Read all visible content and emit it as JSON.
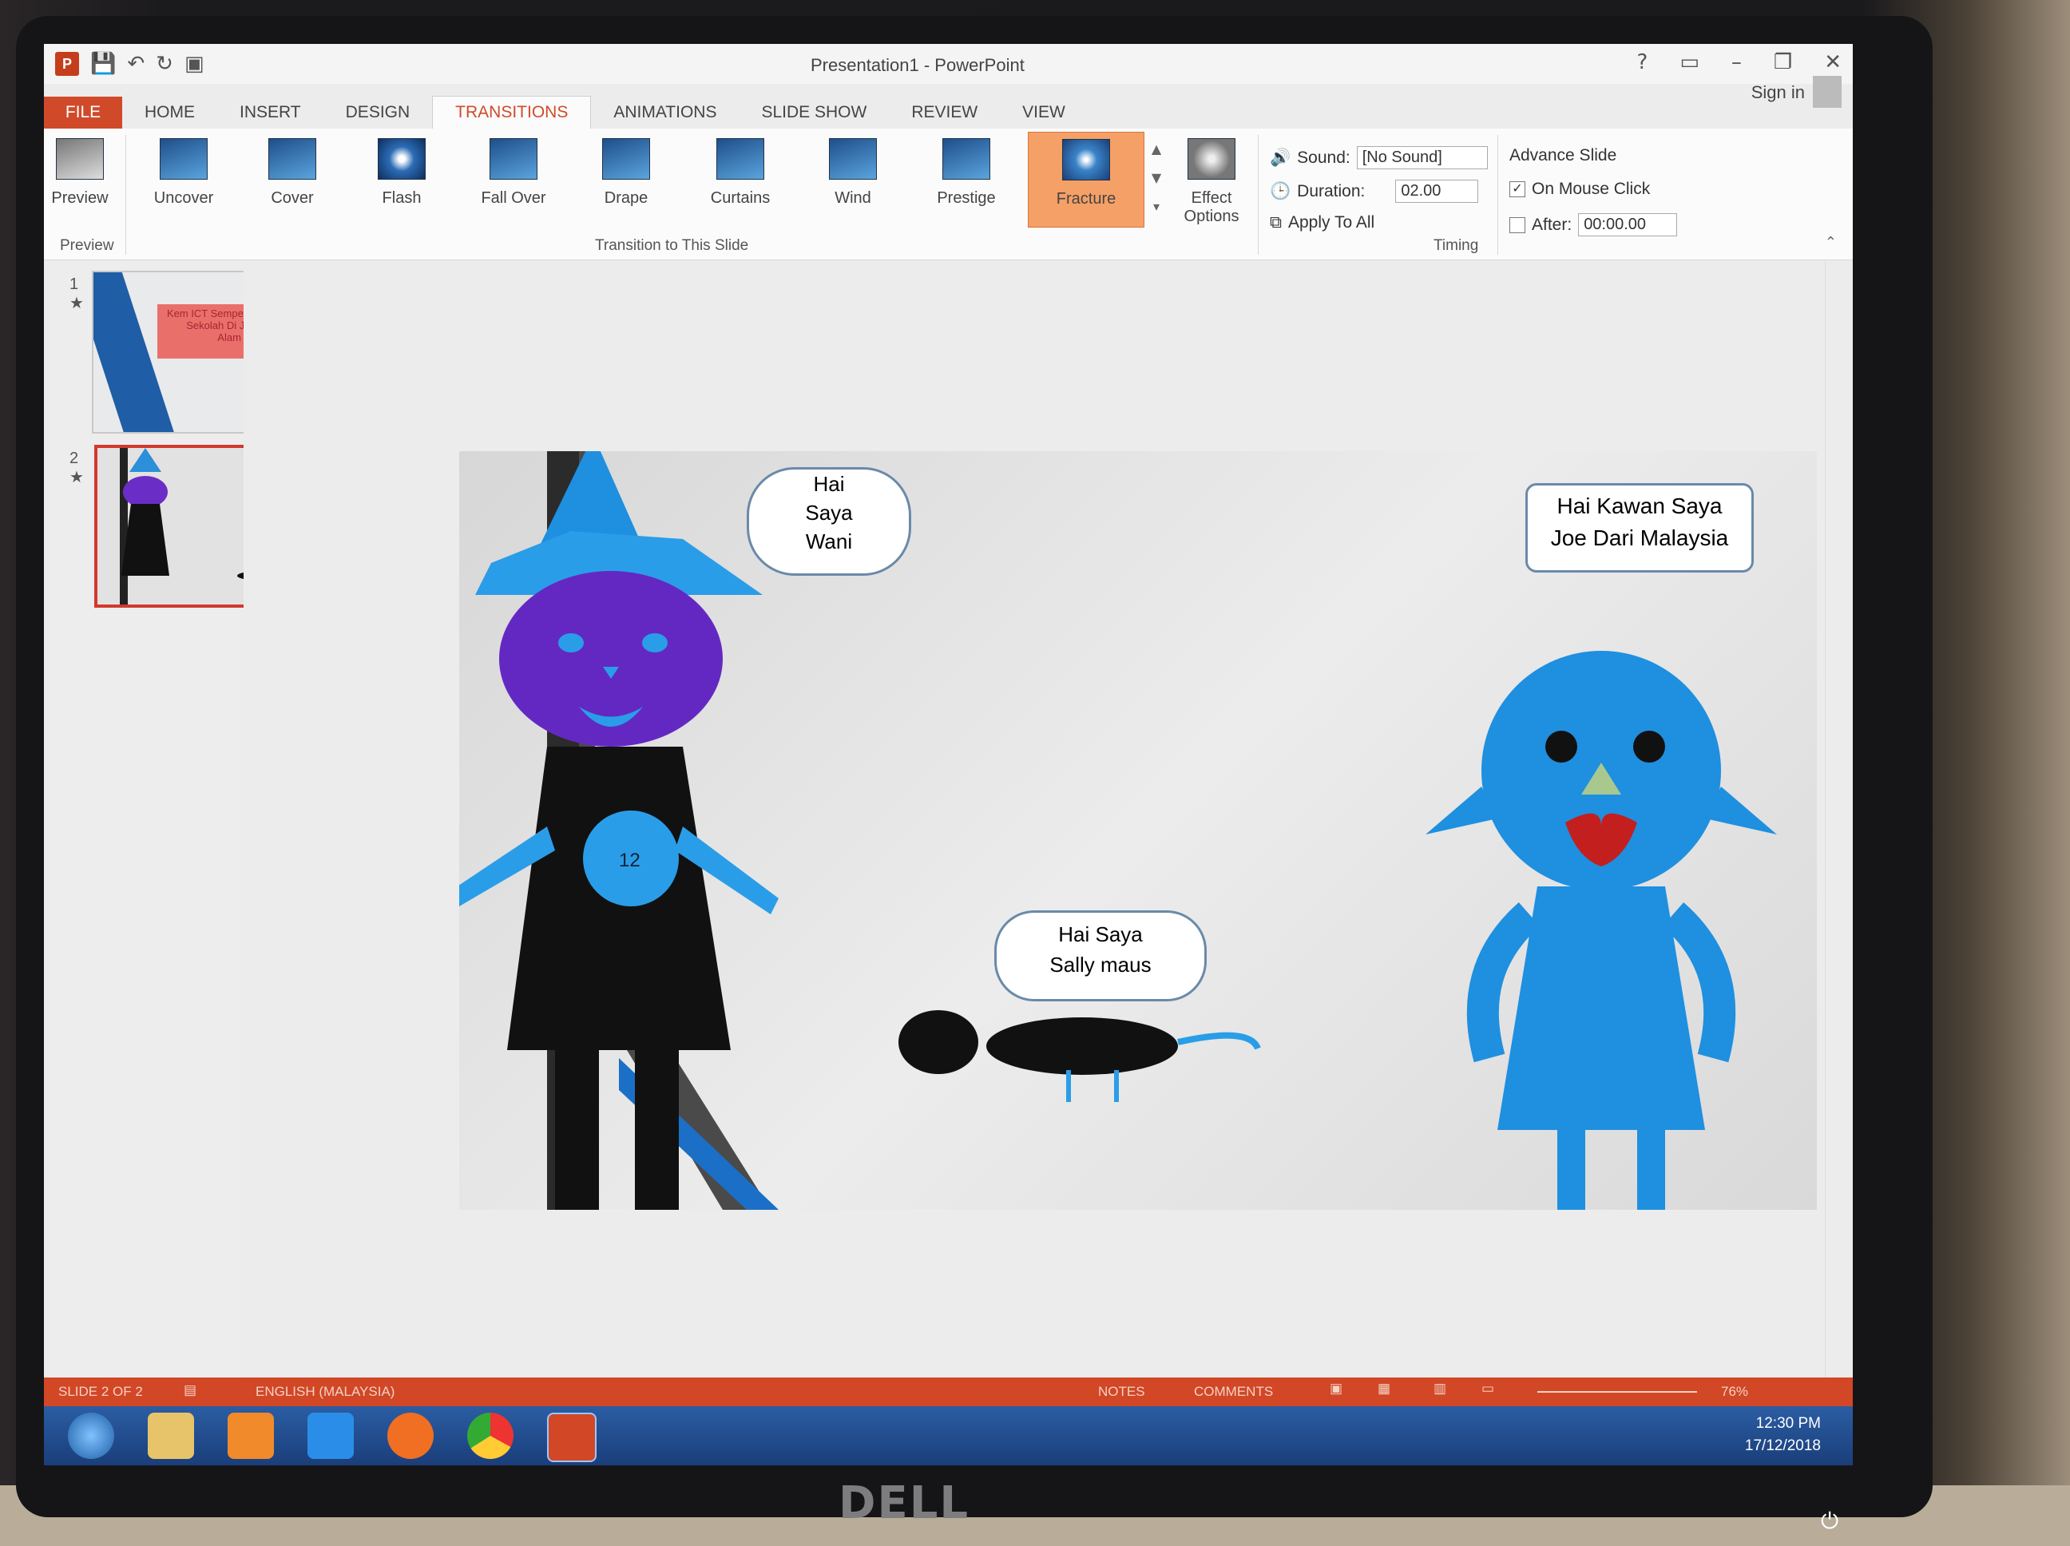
{
  "window": {
    "title": "Presentation1 - PowerPoint",
    "signin": "Sign in",
    "help": "?",
    "controls": [
      "🗗",
      "–",
      "🗖",
      "✕"
    ]
  },
  "qat": {
    "app_icon": "P",
    "save_icon": "save-icon",
    "undo_icon": "undo-icon",
    "redo_icon": "redo-icon"
  },
  "tabs": [
    "FILE",
    "HOME",
    "INSERT",
    "DESIGN",
    "TRANSITIONS",
    "ANIMATIONS",
    "SLIDE SHOW",
    "REVIEW",
    "VIEW"
  ],
  "ribbon": {
    "preview": {
      "label": "Preview",
      "group": "Preview"
    },
    "transitions": [
      {
        "label": "Uncover"
      },
      {
        "label": "Cover"
      },
      {
        "label": "Flash"
      },
      {
        "label": "Fall Over"
      },
      {
        "label": "Drape"
      },
      {
        "label": "Curtains"
      },
      {
        "label": "Wind"
      },
      {
        "label": "Prestige"
      },
      {
        "label": "Fracture"
      }
    ],
    "group_transition": "Transition to This Slide",
    "effect_options": "Effect Options",
    "timing": {
      "sound_label": "Sound:",
      "sound_value": "[No Sound]",
      "duration_label": "Duration:",
      "duration_value": "02.00",
      "apply_all": "Apply To All",
      "advance_label": "Advance Slide",
      "on_click": "On Mouse Click",
      "after_label": "After:",
      "after_value": "00:00.00",
      "group": "Timing"
    }
  },
  "thumbnails": [
    {
      "num": "1",
      "text": "Kem ICT Sempena Cuti Sekolah Di Jabatan Alam Sekitar"
    },
    {
      "num": "2"
    }
  ],
  "slide": {
    "bubble_wani": [
      "Hai",
      "Saya",
      "Wani"
    ],
    "bubble_joe": [
      "Hai Kawan Saya",
      "Joe Dari Malaysia"
    ],
    "bubble_sally": [
      "Hai Saya",
      "Sally maus"
    ],
    "badge": "12"
  },
  "status": {
    "slide": "SLIDE 2 OF 2",
    "lang": "ENGLISH (MALAYSIA)",
    "notes": "NOTES",
    "comments": "COMMENTS",
    "zoom": "76%"
  },
  "taskbar": {
    "time": "12:30 PM",
    "date": "17/12/2018"
  },
  "monitor": {
    "brand": "DELL"
  }
}
